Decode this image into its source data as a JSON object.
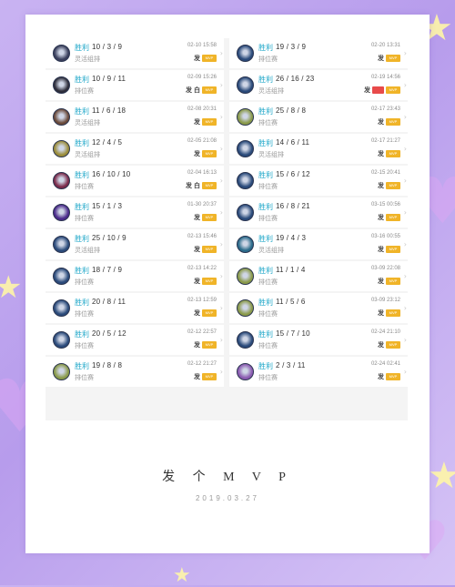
{
  "matches_left": [
    {
      "result": "胜利",
      "kda": "10 / 3 / 9",
      "mode": "灵活组排",
      "time": "02-10 15:58",
      "avatar_color": "#3a3f5c",
      "badges": [
        "发",
        "MVP"
      ]
    },
    {
      "result": "胜利",
      "kda": "10 / 9 / 11",
      "mode": "排位赛",
      "time": "02-09 15:26",
      "avatar_color": "#2d2d3a",
      "badges": [
        "发 白",
        "MVP"
      ]
    },
    {
      "result": "胜利",
      "kda": "11 / 6 / 18",
      "mode": "灵活组排",
      "time": "02-08 20:31",
      "avatar_color": "#6a4a3a",
      "badges": [
        "发",
        "MVP"
      ]
    },
    {
      "result": "胜利",
      "kda": "12 / 4 / 5",
      "mode": "灵活组排",
      "time": "02-05 21:08",
      "avatar_color": "#9a8c3a",
      "badges": [
        "发",
        "MVP"
      ]
    },
    {
      "result": "胜利",
      "kda": "16 / 10 / 10",
      "mode": "排位赛",
      "time": "02-04 16:13",
      "avatar_color": "#7a2a4a",
      "badges": [
        "发 白",
        "MVP"
      ]
    },
    {
      "result": "胜利",
      "kda": "15 / 1 / 3",
      "mode": "排位赛",
      "time": "01-30 20:37",
      "avatar_color": "#4a2a8a",
      "badges": [
        "发",
        "MVP"
      ]
    },
    {
      "result": "胜利",
      "kda": "25 / 10 / 9",
      "mode": "灵活组排",
      "time": "02-13 15:46",
      "avatar_color": "#2a4a7a",
      "badges": [
        "发",
        "MVP"
      ]
    },
    {
      "result": "胜利",
      "kda": "18 / 7 / 9",
      "mode": "排位赛",
      "time": "02-13 14:22",
      "avatar_color": "#2a4a7a",
      "badges": [
        "发",
        "MVP"
      ]
    },
    {
      "result": "胜利",
      "kda": "20 / 8 / 11",
      "mode": "排位赛",
      "time": "02-13 12:59",
      "avatar_color": "#2a4a7a",
      "badges": [
        "发",
        "MVP"
      ]
    },
    {
      "result": "胜利",
      "kda": "20 / 5 / 12",
      "mode": "排位赛",
      "time": "02-12 22:57",
      "avatar_color": "#2a4a7a",
      "badges": [
        "发",
        "MVP"
      ]
    },
    {
      "result": "胜利",
      "kda": "19 / 8 / 8",
      "mode": "排位赛",
      "time": "02-12 21:27",
      "avatar_color": "#8a9a4a",
      "badges": [
        "发",
        "MVP"
      ]
    }
  ],
  "matches_right": [
    {
      "result": "胜利",
      "kda": "19 / 3 / 9",
      "mode": "排位赛",
      "time": "02-20 13:31",
      "avatar_color": "#2a4a7a",
      "badges": [
        "发",
        "MVP"
      ]
    },
    {
      "result": "胜利",
      "kda": "26 / 16 / 23",
      "mode": "灵活组排",
      "time": "02-19 14:56",
      "avatar_color": "#2a4a7a",
      "badges": [
        "发",
        "red",
        "MVP"
      ]
    },
    {
      "result": "胜利",
      "kda": "25 / 8 / 8",
      "mode": "排位赛",
      "time": "02-17 23:43",
      "avatar_color": "#8a9a4a",
      "badges": [
        "发",
        "MVP"
      ]
    },
    {
      "result": "胜利",
      "kda": "14 / 6 / 11",
      "mode": "灵活组排",
      "time": "02-17 21:27",
      "avatar_color": "#2a4a7a",
      "badges": [
        "发",
        "MVP"
      ]
    },
    {
      "result": "胜利",
      "kda": "15 / 6 / 12",
      "mode": "排位赛",
      "time": "02-15 20:41",
      "avatar_color": "#2a4a7a",
      "badges": [
        "发",
        "MVP"
      ]
    },
    {
      "result": "胜利",
      "kda": "16 / 8 / 21",
      "mode": "排位赛",
      "time": "03-15 00:56",
      "avatar_color": "#2a4a7a",
      "badges": [
        "发",
        "MVP"
      ]
    },
    {
      "result": "胜利",
      "kda": "19 / 4 / 3",
      "mode": "灵活组排",
      "time": "03-16 00:55",
      "avatar_color": "#2a6a8a",
      "badges": [
        "发",
        "MVP"
      ]
    },
    {
      "result": "胜利",
      "kda": "11 / 1 / 4",
      "mode": "排位赛",
      "time": "03-09 22:08",
      "avatar_color": "#8a9a4a",
      "badges": [
        "发",
        "MVP"
      ]
    },
    {
      "result": "胜利",
      "kda": "11 / 5 / 6",
      "mode": "排位赛",
      "time": "03-09 23:12",
      "avatar_color": "#8a9a4a",
      "badges": [
        "发",
        "MVP"
      ]
    },
    {
      "result": "胜利",
      "kda": "15 / 7 / 10",
      "mode": "排位赛",
      "time": "02-24 21:10",
      "avatar_color": "#2a4a7a",
      "badges": [
        "发",
        "MVP"
      ]
    },
    {
      "result": "胜利",
      "kda": "2 / 3 / 11",
      "mode": "排位赛",
      "time": "02-24 02:41",
      "avatar_color": "#8a5ab0",
      "badges": [
        "发",
        "MVP"
      ]
    }
  ],
  "mvp_badge_text": "MVP",
  "caption": "发 个 M V P",
  "date": "2019.03.27",
  "colors": {
    "accent_result": "#1fa7c9",
    "mvp_badge": "#f0b428",
    "background": "#c9b3f2"
  }
}
